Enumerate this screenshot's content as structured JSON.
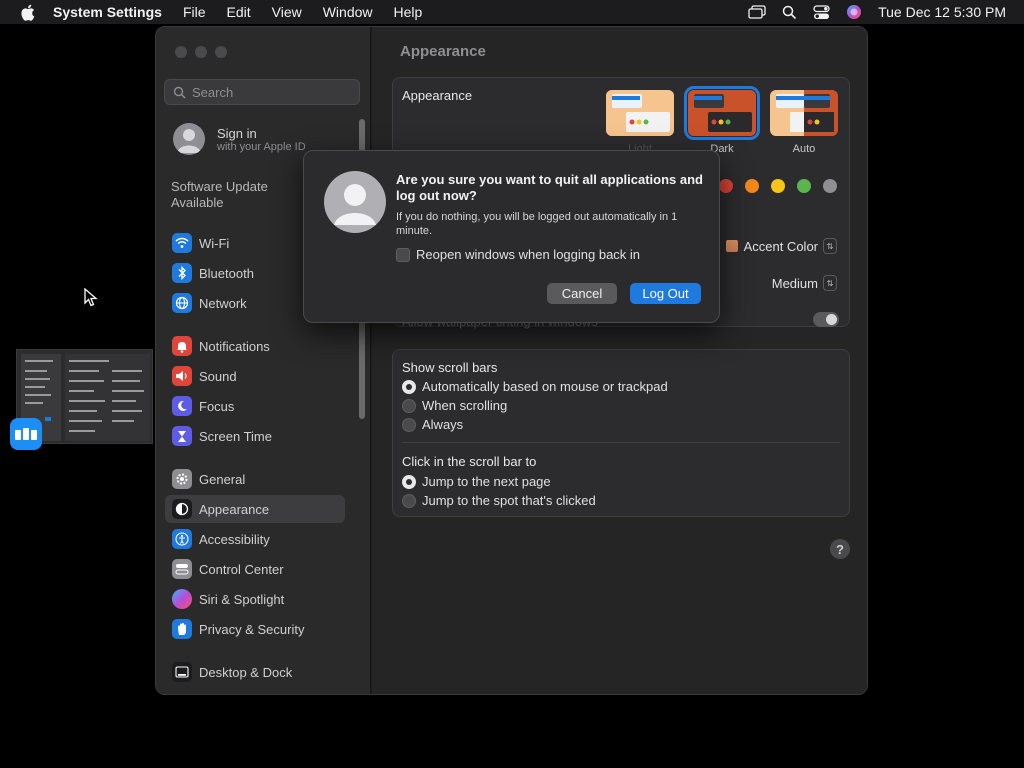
{
  "menubar": {
    "app_name": "System Settings",
    "items": [
      "File",
      "Edit",
      "View",
      "Window",
      "Help"
    ],
    "clock": "Tue Dec 12  5:30 PM"
  },
  "sidebar": {
    "search_placeholder": "Search",
    "signin": {
      "title": "Sign in",
      "subtitle": "with your Apple ID"
    },
    "software_update": "Software Update\nAvailable",
    "items": [
      {
        "label": "Wi-Fi",
        "icon": "wifi-icon",
        "color": "#1f7ae0"
      },
      {
        "label": "Bluetooth",
        "icon": "bluetooth-icon",
        "color": "#1f7ae0"
      },
      {
        "label": "Network",
        "icon": "globe-icon",
        "color": "#1f7ae0"
      },
      {
        "label": "Notifications",
        "icon": "bell-icon",
        "color": "#e0453a"
      },
      {
        "label": "Sound",
        "icon": "speaker-icon",
        "color": "#e0453a"
      },
      {
        "label": "Focus",
        "icon": "moon-icon",
        "color": "#5e5ce6"
      },
      {
        "label": "Screen Time",
        "icon": "hourglass-icon",
        "color": "#5e5ce6"
      },
      {
        "label": "General",
        "icon": "gear-icon",
        "color": "#8e8e93"
      },
      {
        "label": "Appearance",
        "icon": "appearance-icon",
        "color": "#1c1c1e"
      },
      {
        "label": "Accessibility",
        "icon": "accessibility-icon",
        "color": "#1f7ae0"
      },
      {
        "label": "Control Center",
        "icon": "control-center-icon",
        "color": "#8e8e93"
      },
      {
        "label": "Siri & Spotlight",
        "icon": "siri-icon",
        "color": "#b44fd8"
      },
      {
        "label": "Privacy & Security",
        "icon": "hand-icon",
        "color": "#1f7ae0"
      },
      {
        "label": "Desktop & Dock",
        "icon": "dock-icon",
        "color": "#1c1c1e"
      }
    ],
    "active_item": "Appearance"
  },
  "main": {
    "title": "Appearance",
    "appearance_label": "Appearance",
    "modes": [
      {
        "label": "Light",
        "selected": false
      },
      {
        "label": "Dark",
        "selected": true
      },
      {
        "label": "Auto",
        "selected": false
      }
    ],
    "accent_colors": [
      "#e0453a",
      "#f2871a",
      "#f5c518",
      "#5bb44d",
      "#8e8e93"
    ],
    "accent_color_value": "Accent Color",
    "sidebar_icon_size": "Medium",
    "wallpaper_tinting": "Allow wallpaper tinting in windows",
    "show_scroll_bars_heading": "Show scroll bars",
    "scroll_options": [
      {
        "label": "Automatically based on mouse or trackpad",
        "selected": true
      },
      {
        "label": "When scrolling",
        "selected": false
      },
      {
        "label": "Always",
        "selected": false
      }
    ],
    "click_heading": "Click in the scroll bar to",
    "click_options": [
      {
        "label": "Jump to the next page",
        "selected": true
      },
      {
        "label": "Jump to the spot that's clicked",
        "selected": false
      }
    ],
    "help": "?"
  },
  "dialog": {
    "title": "Are you sure you want to quit all applications and log out now?",
    "body": "If you do nothing, you will be logged out automatically in 1 minute.",
    "checkbox_label": "Reopen windows when logging back in",
    "cancel_label": "Cancel",
    "logout_label": "Log Out"
  }
}
